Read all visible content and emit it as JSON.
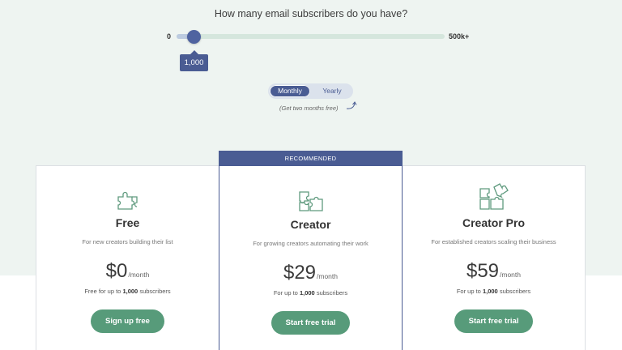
{
  "question": "How many email subscribers do you have?",
  "slider": {
    "min_label": "0",
    "max_label": "500k+",
    "value_label": "1,000",
    "fraction": 0.04
  },
  "billing_toggle": {
    "options": [
      "Monthly",
      "Yearly"
    ],
    "selected": "Monthly",
    "note": "(Get two months free)"
  },
  "recommended_label": "RECOMMENDED",
  "plans": [
    {
      "name": "Free",
      "description": "For new creators building their list",
      "price": "$0",
      "period": "/month",
      "sub_prefix": "Free for up to",
      "sub_count": "1,000",
      "sub_suffix": "subscribers",
      "cta": "Sign up free",
      "icon": "puzzle-piece-icon"
    },
    {
      "name": "Creator",
      "description": "For growing creators automating their work",
      "price": "$29",
      "period": "/month",
      "sub_prefix": "For up to",
      "sub_count": "1,000",
      "sub_suffix": "subscribers",
      "cta": "Start free trial",
      "icon": "puzzle-pieces-icon"
    },
    {
      "name": "Creator Pro",
      "description": "For established creators scaling their business",
      "price": "$59",
      "period": "/month",
      "sub_prefix": "For up to",
      "sub_count": "1,000",
      "sub_suffix": "subscribers",
      "cta": "Start free trial",
      "icon": "puzzle-complete-icon"
    }
  ],
  "colors": {
    "accent": "#4a5c93",
    "cta_green": "#579b7a",
    "band": "#eef4f1",
    "icon_green": "#5f9a7e"
  }
}
